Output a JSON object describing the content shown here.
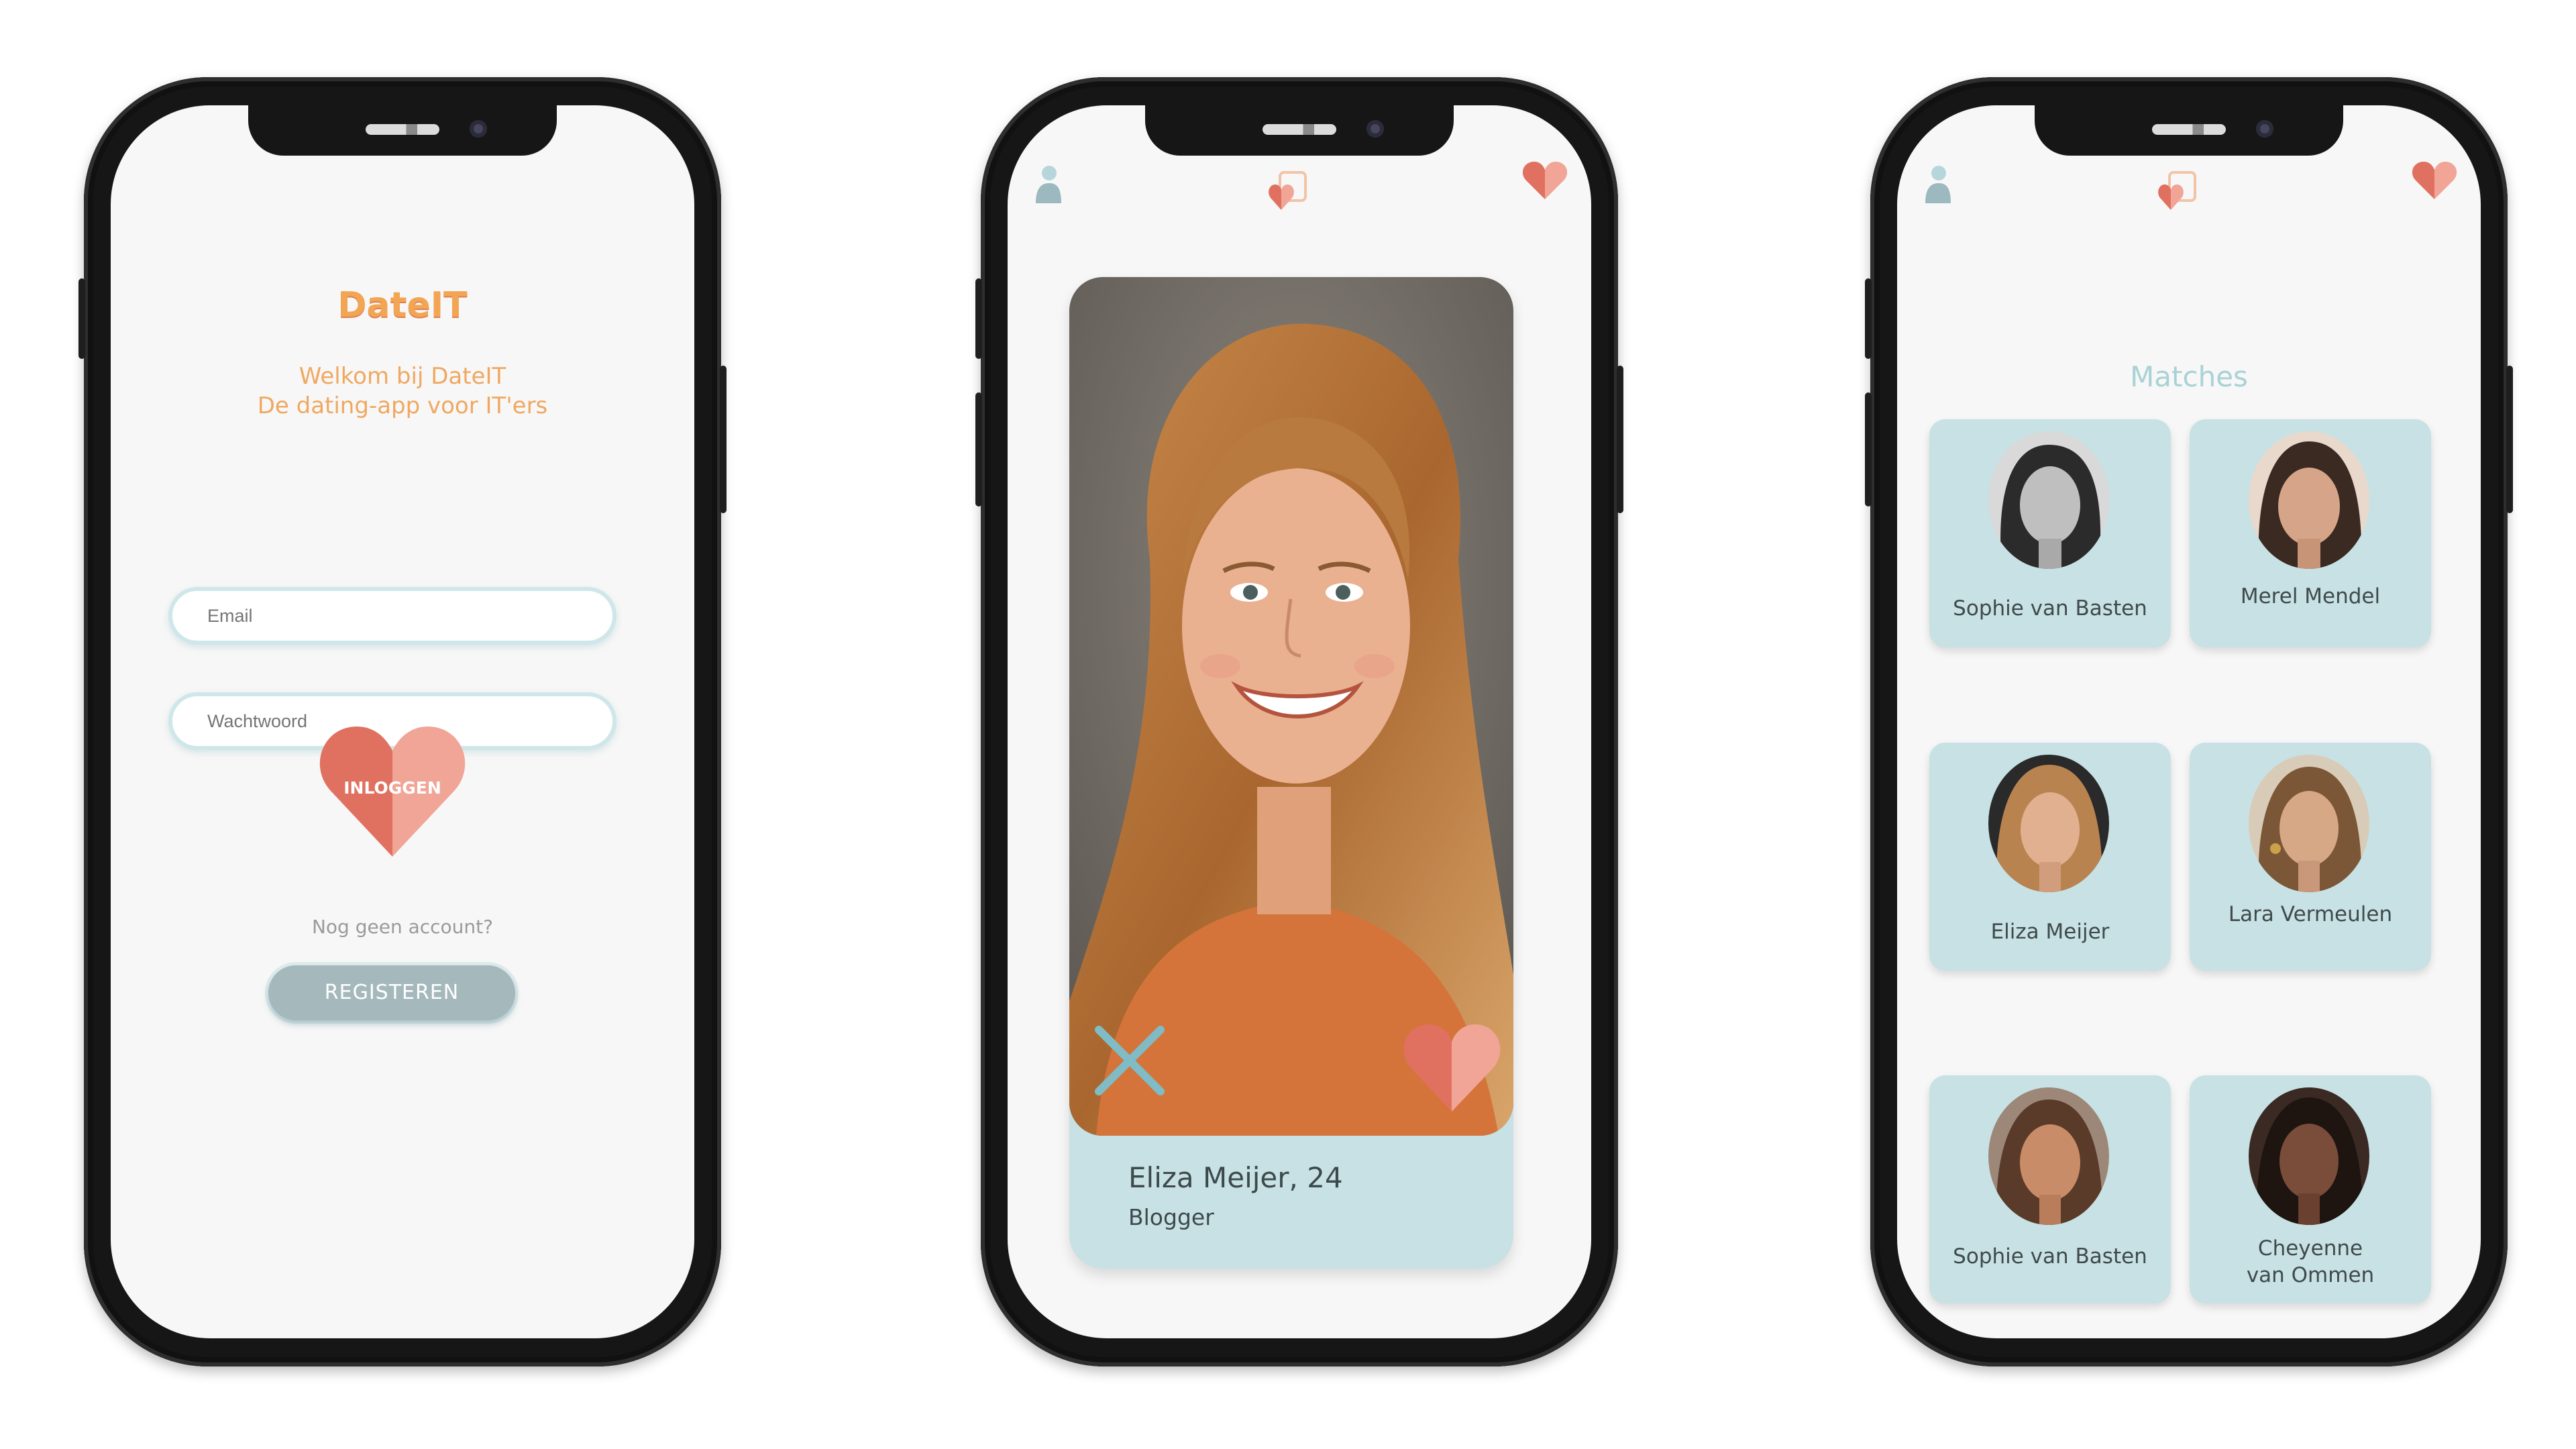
{
  "login": {
    "brand": "DateIT",
    "welcome_line1": "Welkom bij DateIT",
    "welcome_line2": "De dating-app voor IT'ers",
    "email_placeholder": "Email",
    "password_placeholder": "Wachtwoord",
    "login_label": "INLOGGEN",
    "no_account": "Nog geen account?",
    "register_label": "REGISTEREN"
  },
  "swipe": {
    "profile_name": "Eliza Meijer, 24",
    "profile_job": "Blogger",
    "icons": [
      "user-icon",
      "dateit-logo-icon",
      "heart-icon",
      "close-x-icon",
      "like-heart-icon"
    ]
  },
  "matches": {
    "title": "Matches",
    "items": [
      {
        "name": "Sophie van Basten",
        "tone": "#3a3a3a"
      },
      {
        "name": "Merel Mendel",
        "tone": "#6b4636"
      },
      {
        "name": "Eliza Meijer",
        "tone": "#a06a45"
      },
      {
        "name": "Lara Vermeulen",
        "tone": "#9a7752"
      },
      {
        "name": "Sophie van Basten",
        "tone": "#8a5a3e"
      },
      {
        "name": "Cheyenne\nvan Ommen",
        "tone": "#4a3128"
      }
    ]
  },
  "colors": {
    "accent_orange": "#f2a553",
    "heart_red": "#e07160",
    "heart_pink": "#f0a596",
    "card_blue": "#c8e1e4",
    "teal": "#7fbcc6"
  }
}
